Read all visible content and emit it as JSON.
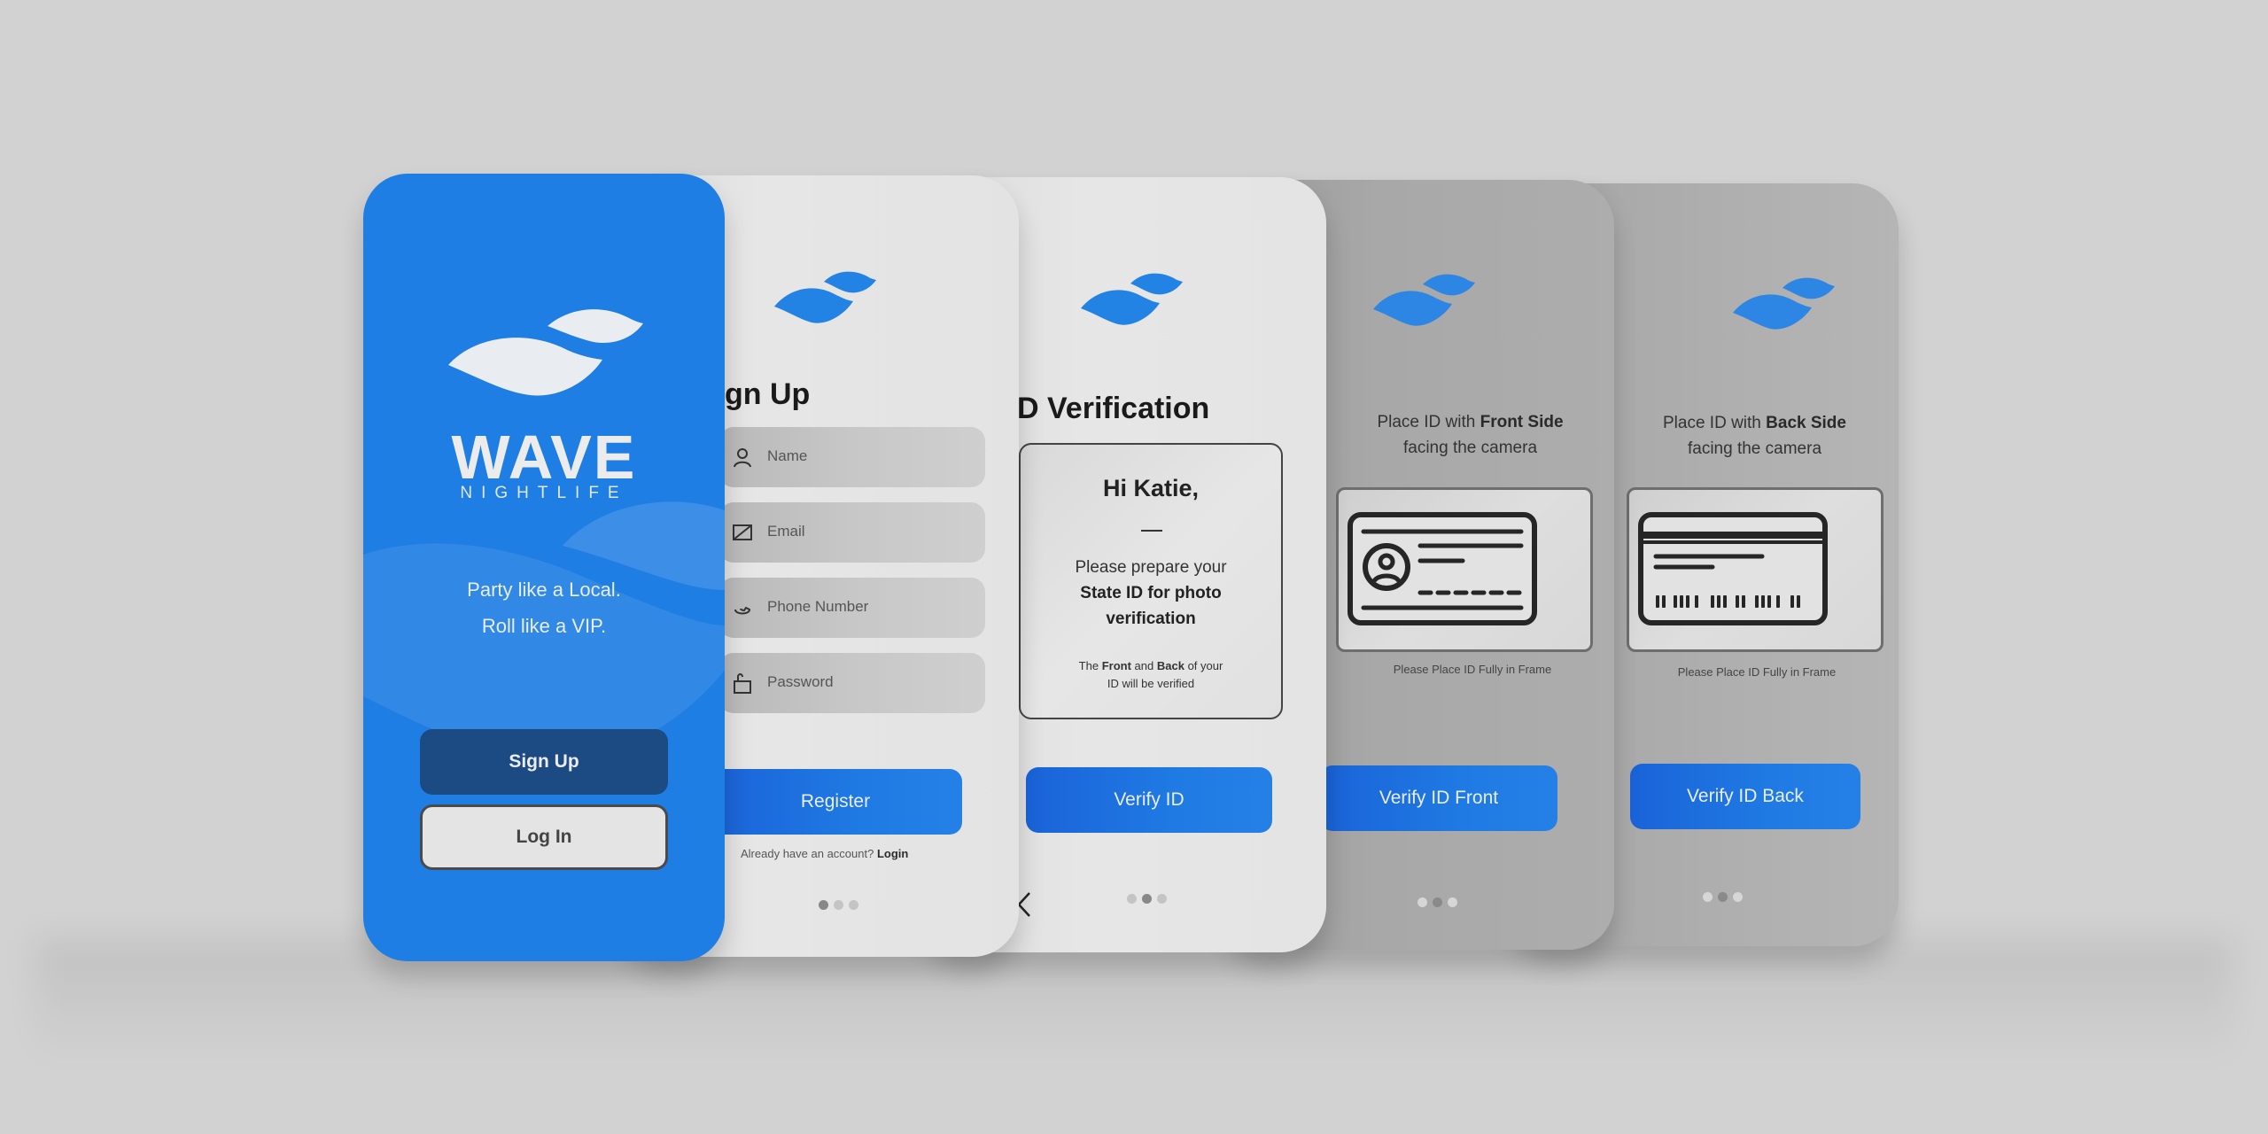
{
  "brand": {
    "name": "WAVE",
    "subtitle": "NIGHTLIFE",
    "tagline_line1": "Party like a Local.",
    "tagline_line2": "Roll like a VIP.",
    "colors": {
      "primary_blue": "#1e7ee4",
      "dark_blue": "#1c4a82",
      "light_gray": "#e4e4e4",
      "background": "#d2d2d2"
    }
  },
  "screens": {
    "welcome": {
      "signup_label": "Sign Up",
      "login_label": "Log In"
    },
    "signup": {
      "title": "Sign Up",
      "title_visible": "gn Up",
      "fields": [
        {
          "icon": "user-icon",
          "placeholder": "Name"
        },
        {
          "icon": "mail-icon",
          "placeholder": "Email"
        },
        {
          "icon": "phone-icon",
          "placeholder": "Phone Number"
        },
        {
          "icon": "lock-icon",
          "placeholder": "Password"
        }
      ],
      "register_label": "Register",
      "already_text": "Already have an account?",
      "login_link": "Login",
      "pager": {
        "current": 1,
        "total": 3
      }
    },
    "id_verification": {
      "title": "ID Verification",
      "title_visible": "D Verification",
      "greeting": "Hi Katie,",
      "message_plain": "Please prepare your",
      "message_bold": "State ID for photo verification",
      "note_prefix": "The",
      "note_front": "Front",
      "note_and": "and",
      "note_back": "Back",
      "note_suffix": "of your",
      "note_line2": "ID will be verified",
      "verify_label": "Verify ID",
      "back_icon": "chevron-left-icon",
      "pager": {
        "current": 2,
        "total": 3
      }
    },
    "id_front": {
      "instruction_prefix": "Place ID with",
      "instruction_bold": "Front Side",
      "instruction_line2": "facing the camera",
      "frame_caption": "Please Place ID Fully in Frame",
      "verify_label": "Verify ID Front",
      "pager": {
        "current": 2,
        "total": 3
      }
    },
    "id_back": {
      "instruction_prefix": "Place ID with",
      "instruction_bold": "Back Side",
      "instruction_line2": "facing the camera",
      "frame_caption": "Please Place ID Fully in Frame",
      "verify_label": "Verify ID Back",
      "pager": {
        "current": 2,
        "total": 3
      }
    }
  }
}
